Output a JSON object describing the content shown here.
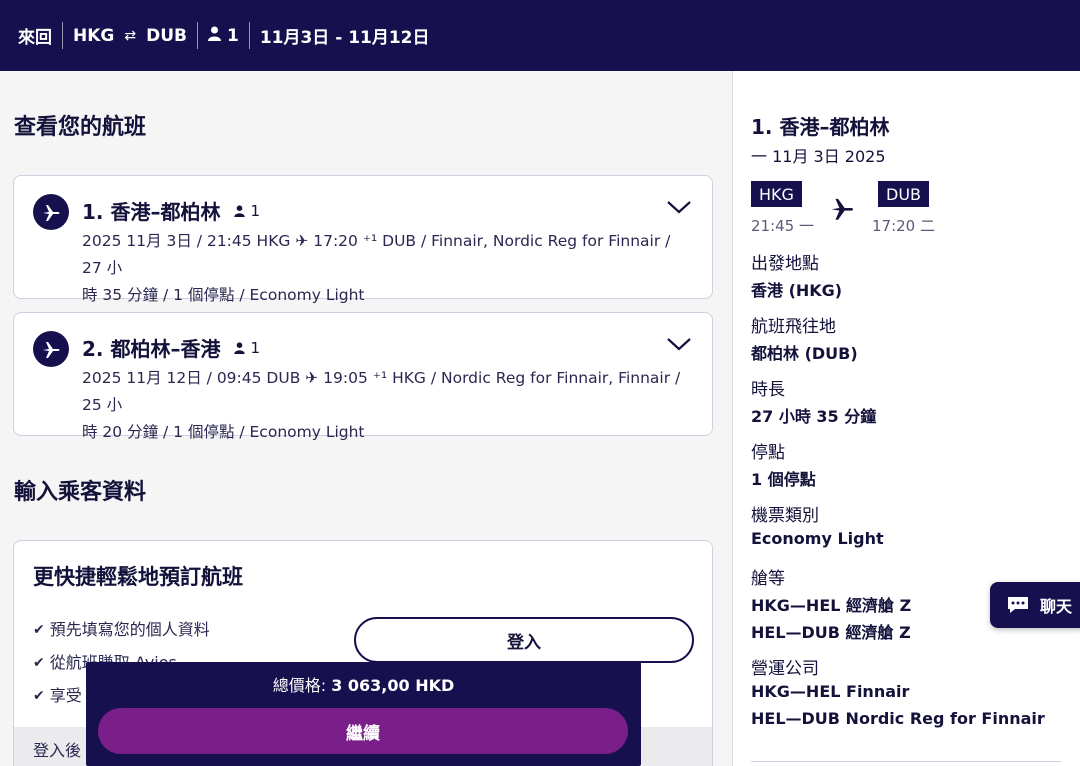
{
  "topbar": {
    "trip_type": "來回",
    "origin": "HKG",
    "destination": "DUB",
    "passengers": "1",
    "dates": "11月3日 - 11月12日"
  },
  "main": {
    "review_title": "查看您的航班",
    "flights": [
      {
        "title": "1. 香港–都柏林",
        "passengers": "1",
        "detail_line1": "2025 11月 3日 / 21:45 HKG ✈ 17:20 ⁺¹ DUB / Finnair, Nordic Reg for Finnair / 27 小",
        "detail_line2": "時 35 分鐘 / 1 個停點 / Economy Light"
      },
      {
        "title": "2. 都柏林–香港",
        "passengers": "1",
        "detail_line1": "2025 11月 12日 / 09:45 DUB ✈ 19:05 ⁺¹ HKG / Nordic Reg for Finnair, Finnair / 25 小",
        "detail_line2": "時 20 分鐘 / 1 個停點 / Economy Light"
      }
    ],
    "passenger_title": "輸入乘客資料",
    "promo": {
      "title": "更快捷輕鬆地預訂航班",
      "benefits": [
        "預先填寫您的個人資料",
        "從航班賺取 Avios",
        "享受"
      ],
      "login_label": "登入",
      "footer_text": "登入後"
    }
  },
  "bottom_bar": {
    "total_label": "總價格: ",
    "total_value": "3 063,00 HKD",
    "continue_label": "繼續"
  },
  "sidebar": {
    "title": "1. 香港–都柏林",
    "date": "一 11月 3日 2025",
    "origin_code": "HKG",
    "dest_code": "DUB",
    "depart_time": "21:45 一",
    "arrive_time": "17:20 二",
    "details": [
      {
        "label": "出發地點",
        "value": "香港 (HKG)"
      },
      {
        "label": "航班飛往地",
        "value": "都柏林 (DUB)"
      },
      {
        "label": "時長",
        "value": "27 小時 35 分鐘"
      },
      {
        "label": "停點",
        "value": "1 個停點"
      },
      {
        "label": "機票類別",
        "value": "Economy Light"
      }
    ],
    "cabin_label": "艙等",
    "cabin_values": [
      "HKG—HEL 經濟艙 Z",
      "HEL—DUB 經濟艙 Z"
    ],
    "operator_label": "營運公司",
    "operator_values": [
      "HKG—HEL Finnair",
      "HEL—DUB Nordic Reg for Finnair"
    ]
  },
  "chat": {
    "label": "聊天"
  },
  "colors": {
    "navy": "#17104f",
    "purple": "#7a1f89"
  }
}
